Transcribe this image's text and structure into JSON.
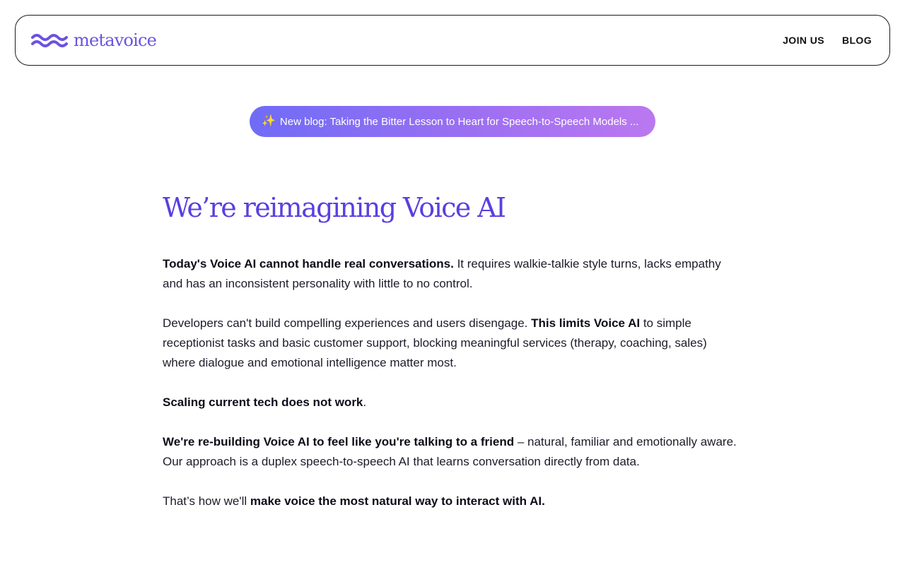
{
  "nav": {
    "logo_text": "metavoice",
    "links": [
      "JOIN US",
      "BLOG"
    ]
  },
  "banner": {
    "icon": "sparkle-icon",
    "text": "New blog: Taking the Bitter Lesson to Heart for Speech-to-Speech Models ..."
  },
  "hero": {
    "headline": "We’re reimagining Voice AI",
    "p1_bold": "Today's Voice AI cannot handle real conversations.",
    "p1_rest": " It requires walkie-talkie style turns, lacks empathy and has an inconsistent personality with little to no control.",
    "p2_start": "Developers can't build compelling experiences and users disengage. ",
    "p2_bold": "This limits Voice AI",
    "p2_rest": " to simple receptionist tasks and basic customer support, blocking meaningful services (therapy, coaching, sales) where dialogue and emotional intelligence matter most.",
    "p3_bold": "Scaling current tech does not work",
    "p3_rest": ".",
    "p4_bold": "We're re-building Voice AI to feel like you're talking to a friend",
    "p4_rest": " – natural, familiar and emotionally aware. Our approach is a duplex speech-to-speech AI that learns conversation directly from data.",
    "p5_start": "That’s how we'll ",
    "p5_bold": "make voice the most natural way to interact with AI."
  },
  "colors": {
    "brand": "#6b52e0",
    "headline": "#5a3fe0",
    "banner_start": "#6f6cf6",
    "banner_end": "#bb78f0"
  }
}
